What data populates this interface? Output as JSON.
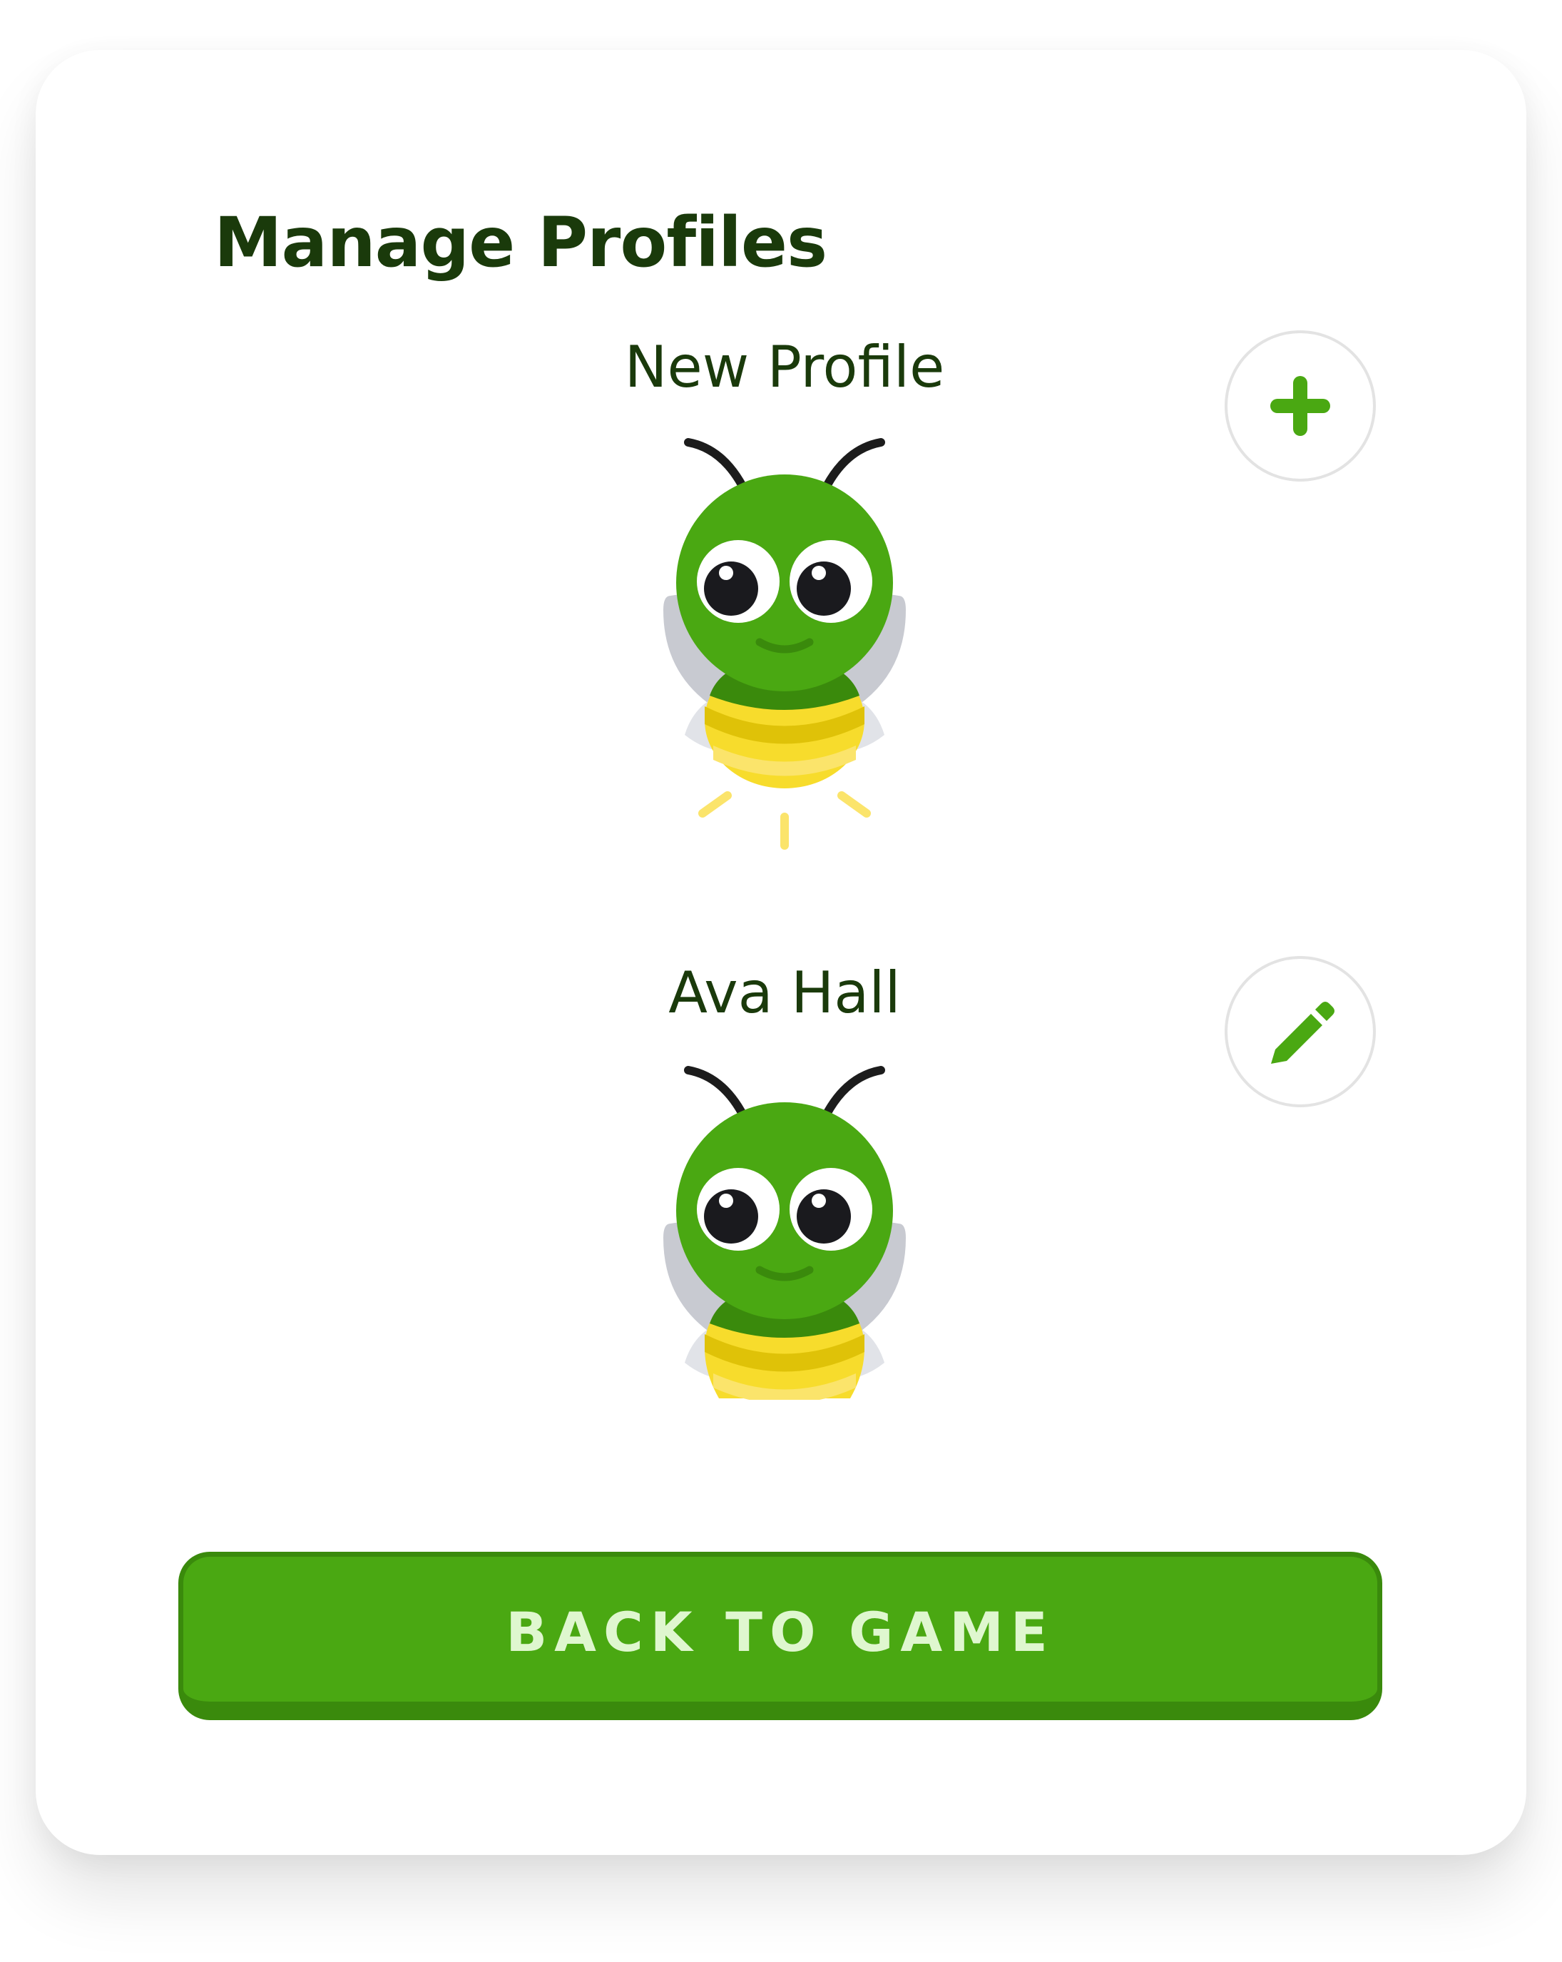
{
  "header": {
    "title": "Manage Profiles"
  },
  "profiles": [
    {
      "name": "New Profile",
      "action": "add",
      "action_icon": "plus-icon",
      "avatar": "bee-avatar",
      "glowing": true
    },
    {
      "name": "Ava Hall",
      "action": "edit",
      "action_icon": "pencil-icon",
      "avatar": "bee-avatar",
      "glowing": false
    }
  ],
  "footer": {
    "back_label": "BACK TO GAME"
  },
  "colors": {
    "brand_green": "#4aa812",
    "brand_green_dark": "#3a8a0c",
    "title_text": "#1a3a0b",
    "bee_yellow": "#f7dc2c",
    "wing_gray": "#c8cad1"
  }
}
